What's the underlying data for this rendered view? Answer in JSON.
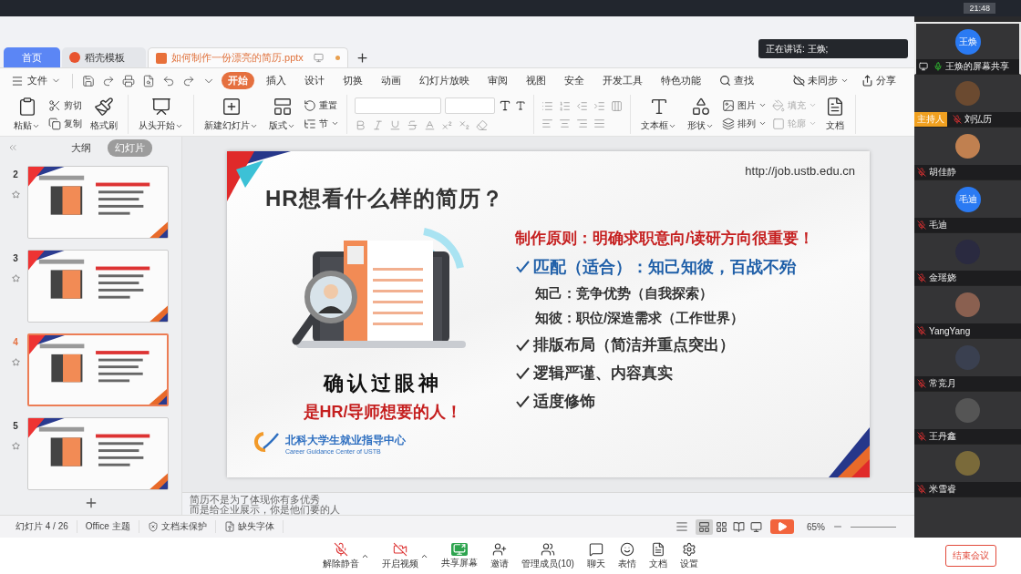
{
  "clock": "21:48",
  "toast": {
    "text": "正在讲话: 王焕;"
  },
  "doc_tabs": [
    {
      "label": "首页",
      "kind": "home",
      "selected": false
    },
    {
      "label": "稻壳模板",
      "kind": "template",
      "selected": false
    },
    {
      "label": "如何制作一份漂亮的简历.pptx",
      "kind": "document",
      "selected": true
    }
  ],
  "file_menu": "文件",
  "ribbon_tabs": [
    {
      "label": "开始",
      "selected": true
    },
    {
      "label": "插入",
      "selected": false
    },
    {
      "label": "设计",
      "selected": false
    },
    {
      "label": "切换",
      "selected": false
    },
    {
      "label": "动画",
      "selected": false
    },
    {
      "label": "幻灯片放映",
      "selected": false
    },
    {
      "label": "审阅",
      "selected": false
    },
    {
      "label": "视图",
      "selected": false
    },
    {
      "label": "安全",
      "selected": false
    },
    {
      "label": "开发工具",
      "selected": false
    },
    {
      "label": "特色功能",
      "selected": false
    }
  ],
  "search": "查找",
  "sync": "未同步",
  "share": "分享",
  "ribbon_groups": [
    {
      "kind": "tools",
      "items": [
        {
          "label": "粘贴",
          "kind": "large",
          "dropdown": true,
          "disabled": false
        },
        {
          "label": "剪切",
          "kind": "small",
          "dropdown": false,
          "disabled": false
        },
        {
          "label": "复制",
          "kind": "small",
          "dropdown": false,
          "disabled": false
        },
        {
          "label": "格式刷",
          "kind": "large",
          "dropdown": false,
          "disabled": false
        }
      ]
    },
    {
      "kind": "tools",
      "items": [
        {
          "label": "从头开始",
          "kind": "large",
          "dropdown": true,
          "disabled": false
        }
      ]
    },
    {
      "kind": "tools",
      "items": [
        {
          "label": "新建幻灯片",
          "kind": "large",
          "dropdown": true,
          "disabled": false
        },
        {
          "label": "版式",
          "kind": "large",
          "dropdown": true,
          "disabled": false
        },
        {
          "label": "重置",
          "kind": "small",
          "dropdown": false,
          "disabled": false
        },
        {
          "label": "节",
          "kind": "small",
          "dropdown": true,
          "disabled": false
        }
      ]
    },
    {
      "kind": "font"
    },
    {
      "kind": "paragraph"
    },
    {
      "kind": "tools",
      "items": [
        {
          "label": "文本框",
          "kind": "large",
          "dropdown": true,
          "disabled": false
        },
        {
          "label": "形状",
          "kind": "large",
          "dropdown": true,
          "disabled": false
        },
        {
          "label": "图片",
          "kind": "small",
          "dropdown": true,
          "disabled": false
        },
        {
          "label": "排列",
          "kind": "small",
          "dropdown": true,
          "disabled": false
        },
        {
          "label": "填充",
          "kind": "small",
          "dropdown": true,
          "disabled": true
        },
        {
          "label": "轮廓",
          "kind": "small",
          "dropdown": true,
          "disabled": true
        },
        {
          "label": "文档",
          "kind": "large",
          "dropdown": false,
          "disabled": false
        }
      ]
    }
  ],
  "view_tabs": [
    {
      "label": "大纲",
      "selected": false
    },
    {
      "label": "幻灯片",
      "selected": true
    }
  ],
  "thumbnails": [
    {
      "number": "2",
      "selected": false
    },
    {
      "number": "3",
      "selected": false
    },
    {
      "number": "4",
      "selected": true
    },
    {
      "number": "5",
      "selected": false
    }
  ],
  "slide": {
    "url": "http://job.ustb.edu.cn",
    "title": "HR想看什么样的简历？",
    "slogan": "确认过眼神",
    "tagline": "是HR/导师想要的人！",
    "principle": "制作原则：明确求职意向/读研方向很重要！",
    "points": [
      {
        "text": "匹配（适合）：知己知彼，百战不殆",
        "kind": "highlight",
        "children": [
          {
            "text": "知己：竞争优势（自我探索）"
          },
          {
            "text": "知彼：职位/深造需求（工作世界）"
          }
        ]
      },
      {
        "text": "排版布局（简洁并重点突出）",
        "kind": "normal"
      },
      {
        "text": "逻辑严谨、内容真实",
        "kind": "normal"
      },
      {
        "text": "适度修饰",
        "kind": "normal"
      }
    ],
    "logo_name": "北科大学生就业指导中心",
    "logo_english": "Career Guidance Center of USTB"
  },
  "notes": [
    "简历不是为了体现你有多优秀",
    "而是给企业展示，你是他们要的人"
  ],
  "status_bar": {
    "slide_counter": "幻灯片 4 / 26",
    "theme": "Office 主题",
    "protection": "文档未保护",
    "fonts": "缺失字体",
    "zoom": "65%"
  },
  "view_modes": [
    {
      "selected": true
    },
    {
      "selected": false
    },
    {
      "selected": false
    },
    {
      "selected": false
    }
  ],
  "participants": [
    {
      "name": "王焕的屏幕共享",
      "avatar": "王焕",
      "kind": "letter",
      "muted": false,
      "host": false,
      "sharing": true,
      "selected": true
    },
    {
      "name": "刘弘历",
      "kind": "photo",
      "muted": true,
      "host": true,
      "host_label": "主持人",
      "sharing": false,
      "selected": false
    },
    {
      "name": "胡佳静",
      "kind": "photo",
      "muted": true,
      "host": false,
      "sharing": false,
      "selected": false
    },
    {
      "name": "毛迪",
      "avatar": "毛迪",
      "kind": "letter",
      "muted": true,
      "host": false,
      "sharing": false,
      "selected": false
    },
    {
      "name": "金瑶娆",
      "kind": "photo",
      "muted": true,
      "host": false,
      "sharing": false,
      "selected": false
    },
    {
      "name": "YangYang",
      "kind": "photo",
      "muted": true,
      "host": false,
      "sharing": false,
      "selected": false
    },
    {
      "name": "常竞月",
      "kind": "photo",
      "muted": true,
      "host": false,
      "sharing": false,
      "selected": false
    },
    {
      "name": "王丹鑫",
      "kind": "photo",
      "muted": true,
      "host": false,
      "sharing": false,
      "selected": false
    },
    {
      "name": "米雪睿",
      "kind": "photo",
      "muted": true,
      "host": false,
      "sharing": false,
      "selected": false
    }
  ],
  "meeting_toolbar": [
    {
      "label": "解除静音",
      "menu": true,
      "off": true
    },
    {
      "label": "开启视频",
      "menu": true,
      "off": true
    },
    {
      "label": "共享屏幕",
      "menu": false,
      "off": false
    },
    {
      "label": "邀请",
      "menu": false,
      "off": false
    },
    {
      "label": "管理成员(10)",
      "menu": false,
      "off": false
    },
    {
      "label": "聊天",
      "menu": false,
      "off": false
    },
    {
      "label": "表情",
      "menu": false,
      "off": false
    },
    {
      "label": "文档",
      "menu": false,
      "off": false
    },
    {
      "label": "设置",
      "menu": false,
      "off": false
    }
  ],
  "end_meeting": "结束会议"
}
